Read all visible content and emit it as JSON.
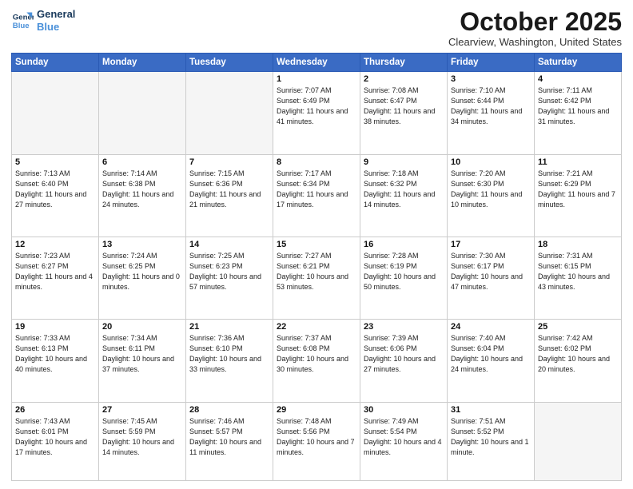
{
  "header": {
    "logo_line1": "General",
    "logo_line2": "Blue",
    "month_title": "October 2025",
    "location": "Clearview, Washington, United States"
  },
  "days_of_week": [
    "Sunday",
    "Monday",
    "Tuesday",
    "Wednesday",
    "Thursday",
    "Friday",
    "Saturday"
  ],
  "weeks": [
    [
      {
        "num": "",
        "info": ""
      },
      {
        "num": "",
        "info": ""
      },
      {
        "num": "",
        "info": ""
      },
      {
        "num": "1",
        "info": "Sunrise: 7:07 AM\nSunset: 6:49 PM\nDaylight: 11 hours and 41 minutes."
      },
      {
        "num": "2",
        "info": "Sunrise: 7:08 AM\nSunset: 6:47 PM\nDaylight: 11 hours and 38 minutes."
      },
      {
        "num": "3",
        "info": "Sunrise: 7:10 AM\nSunset: 6:44 PM\nDaylight: 11 hours and 34 minutes."
      },
      {
        "num": "4",
        "info": "Sunrise: 7:11 AM\nSunset: 6:42 PM\nDaylight: 11 hours and 31 minutes."
      }
    ],
    [
      {
        "num": "5",
        "info": "Sunrise: 7:13 AM\nSunset: 6:40 PM\nDaylight: 11 hours and 27 minutes."
      },
      {
        "num": "6",
        "info": "Sunrise: 7:14 AM\nSunset: 6:38 PM\nDaylight: 11 hours and 24 minutes."
      },
      {
        "num": "7",
        "info": "Sunrise: 7:15 AM\nSunset: 6:36 PM\nDaylight: 11 hours and 21 minutes."
      },
      {
        "num": "8",
        "info": "Sunrise: 7:17 AM\nSunset: 6:34 PM\nDaylight: 11 hours and 17 minutes."
      },
      {
        "num": "9",
        "info": "Sunrise: 7:18 AM\nSunset: 6:32 PM\nDaylight: 11 hours and 14 minutes."
      },
      {
        "num": "10",
        "info": "Sunrise: 7:20 AM\nSunset: 6:30 PM\nDaylight: 11 hours and 10 minutes."
      },
      {
        "num": "11",
        "info": "Sunrise: 7:21 AM\nSunset: 6:29 PM\nDaylight: 11 hours and 7 minutes."
      }
    ],
    [
      {
        "num": "12",
        "info": "Sunrise: 7:23 AM\nSunset: 6:27 PM\nDaylight: 11 hours and 4 minutes."
      },
      {
        "num": "13",
        "info": "Sunrise: 7:24 AM\nSunset: 6:25 PM\nDaylight: 11 hours and 0 minutes."
      },
      {
        "num": "14",
        "info": "Sunrise: 7:25 AM\nSunset: 6:23 PM\nDaylight: 10 hours and 57 minutes."
      },
      {
        "num": "15",
        "info": "Sunrise: 7:27 AM\nSunset: 6:21 PM\nDaylight: 10 hours and 53 minutes."
      },
      {
        "num": "16",
        "info": "Sunrise: 7:28 AM\nSunset: 6:19 PM\nDaylight: 10 hours and 50 minutes."
      },
      {
        "num": "17",
        "info": "Sunrise: 7:30 AM\nSunset: 6:17 PM\nDaylight: 10 hours and 47 minutes."
      },
      {
        "num": "18",
        "info": "Sunrise: 7:31 AM\nSunset: 6:15 PM\nDaylight: 10 hours and 43 minutes."
      }
    ],
    [
      {
        "num": "19",
        "info": "Sunrise: 7:33 AM\nSunset: 6:13 PM\nDaylight: 10 hours and 40 minutes."
      },
      {
        "num": "20",
        "info": "Sunrise: 7:34 AM\nSunset: 6:11 PM\nDaylight: 10 hours and 37 minutes."
      },
      {
        "num": "21",
        "info": "Sunrise: 7:36 AM\nSunset: 6:10 PM\nDaylight: 10 hours and 33 minutes."
      },
      {
        "num": "22",
        "info": "Sunrise: 7:37 AM\nSunset: 6:08 PM\nDaylight: 10 hours and 30 minutes."
      },
      {
        "num": "23",
        "info": "Sunrise: 7:39 AM\nSunset: 6:06 PM\nDaylight: 10 hours and 27 minutes."
      },
      {
        "num": "24",
        "info": "Sunrise: 7:40 AM\nSunset: 6:04 PM\nDaylight: 10 hours and 24 minutes."
      },
      {
        "num": "25",
        "info": "Sunrise: 7:42 AM\nSunset: 6:02 PM\nDaylight: 10 hours and 20 minutes."
      }
    ],
    [
      {
        "num": "26",
        "info": "Sunrise: 7:43 AM\nSunset: 6:01 PM\nDaylight: 10 hours and 17 minutes."
      },
      {
        "num": "27",
        "info": "Sunrise: 7:45 AM\nSunset: 5:59 PM\nDaylight: 10 hours and 14 minutes."
      },
      {
        "num": "28",
        "info": "Sunrise: 7:46 AM\nSunset: 5:57 PM\nDaylight: 10 hours and 11 minutes."
      },
      {
        "num": "29",
        "info": "Sunrise: 7:48 AM\nSunset: 5:56 PM\nDaylight: 10 hours and 7 minutes."
      },
      {
        "num": "30",
        "info": "Sunrise: 7:49 AM\nSunset: 5:54 PM\nDaylight: 10 hours and 4 minutes."
      },
      {
        "num": "31",
        "info": "Sunrise: 7:51 AM\nSunset: 5:52 PM\nDaylight: 10 hours and 1 minute."
      },
      {
        "num": "",
        "info": ""
      }
    ]
  ]
}
